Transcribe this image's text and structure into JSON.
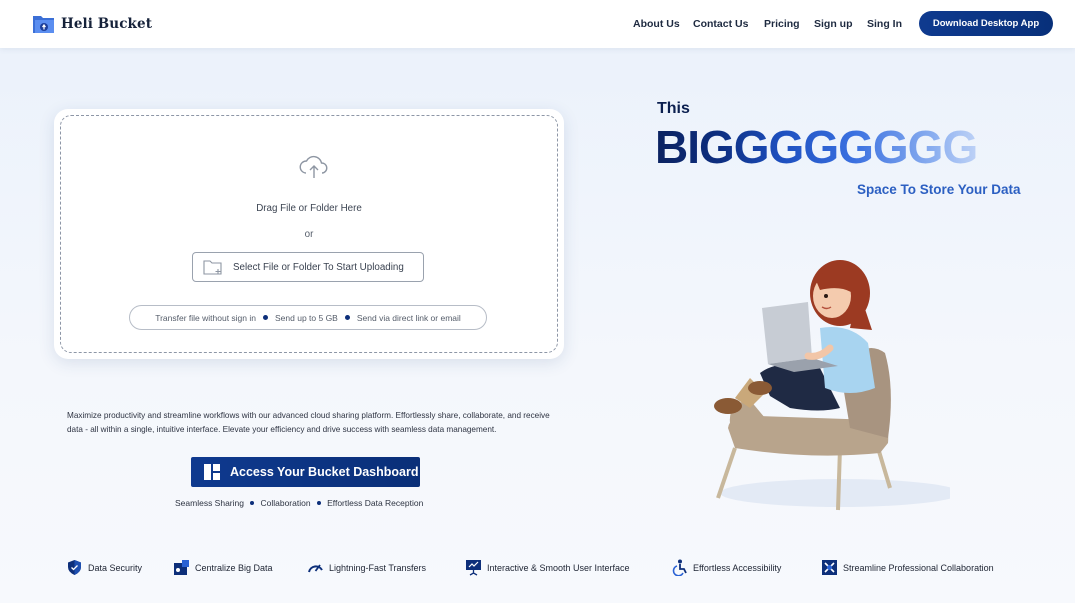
{
  "header": {
    "brand": "Heli Bucket",
    "nav": [
      "About Us",
      "Contact Us",
      "Pricing",
      "Sign up",
      "Sing In"
    ],
    "download_label": "Download Desktop App"
  },
  "upload": {
    "drag_text": "Drag File or Folder Here",
    "or_text": "or",
    "select_label": "Select File or Folder To Start Uploading",
    "features": [
      "Transfer file without sign in",
      "Send up to 5 GB",
      "Send via direct link or email"
    ]
  },
  "hero": {
    "this": "This",
    "big": "BIGGGGGGGG",
    "space": "Space To Store Your Data"
  },
  "main": {
    "description": "Maximize productivity and streamline workflows with our advanced cloud sharing platform. Effortlessly share, collaborate, and receive data - all within a single, intuitive interface. Elevate your efficiency and drive success with seamless data management.",
    "dashboard_label": "Access Your Bucket Dashboard",
    "sub_features": [
      "Seamless Sharing",
      "Collaboration",
      "Effortless Data Reception"
    ]
  },
  "bottom_features": [
    {
      "label": "Data Security",
      "icon": "shield-icon"
    },
    {
      "label": "Centralize Big Data",
      "icon": "data-icon"
    },
    {
      "label": "Lightning-Fast Transfers",
      "icon": "speedometer-icon"
    },
    {
      "label": "Interactive & Smooth User Interface",
      "icon": "presentation-icon"
    },
    {
      "label": "Effortless Accessibility",
      "icon": "accessibility-icon"
    },
    {
      "label": "Streamline Professional Collaboration",
      "icon": "collaboration-icon"
    }
  ],
  "colors": {
    "brand": "#0f3a8f",
    "accent": "#2c5fc2"
  }
}
